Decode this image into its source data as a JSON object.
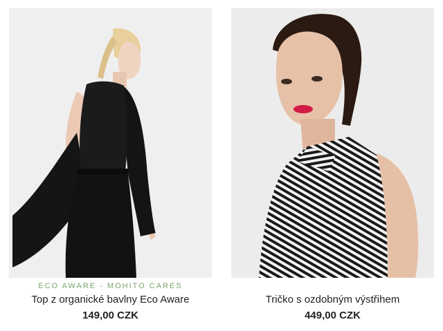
{
  "products": [
    {
      "tag": "ECO AWARE - MOHITO CARES",
      "name": "Top z organické bavlny Eco Aware",
      "price": "149,00 CZK",
      "image": "woman-black-tank-top-photo"
    },
    {
      "tag": "",
      "name": "Tričko s ozdobným výstřihem",
      "price": "449,00 CZK",
      "image": "woman-striped-top-photo"
    }
  ],
  "colors": {
    "tag_green": "#7aa46a",
    "text": "#222222",
    "photo_bg": "#eeeeee"
  }
}
